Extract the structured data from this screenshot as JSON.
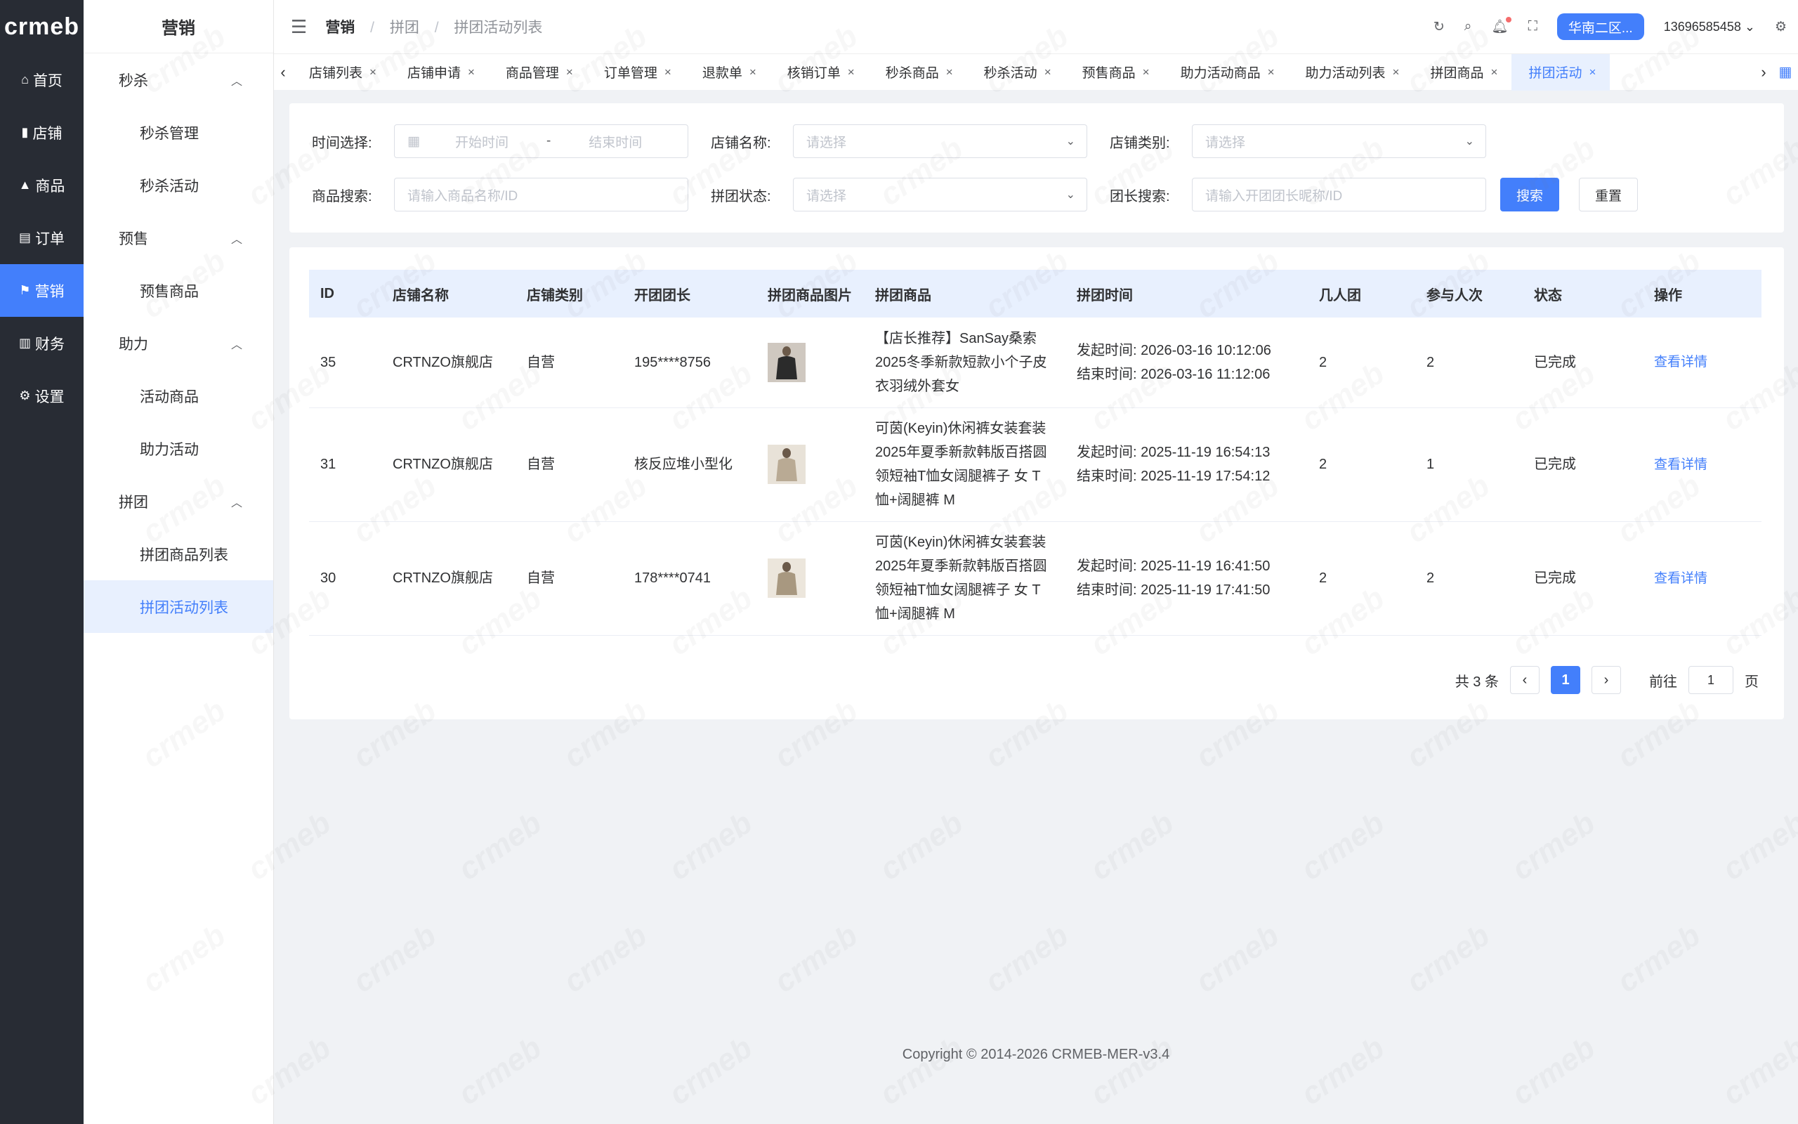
{
  "app": {
    "logo_text": "crmeb",
    "accent": "#437ffb"
  },
  "rail": [
    {
      "label": "首页",
      "icon": "home-icon",
      "glyph": "⌂"
    },
    {
      "label": "店铺",
      "icon": "store-icon",
      "glyph": "▮"
    },
    {
      "label": "商品",
      "icon": "product-icon",
      "glyph": "▲"
    },
    {
      "label": "订单",
      "icon": "order-icon",
      "glyph": "▤"
    },
    {
      "label": "营销",
      "icon": "marketing-flag-icon",
      "glyph": "⚑"
    },
    {
      "label": "财务",
      "icon": "finance-chart-icon",
      "glyph": "▥"
    },
    {
      "label": "设置",
      "icon": "settings-gear-icon",
      "glyph": "⚙"
    }
  ],
  "submenu": {
    "title": "营销",
    "groups": [
      {
        "label": "秒杀",
        "items": [
          "秒杀管理",
          "秒杀活动"
        ]
      },
      {
        "label": "预售",
        "items": [
          "预售商品"
        ]
      },
      {
        "label": "助力",
        "items": [
          "活动商品",
          "助力活动"
        ]
      },
      {
        "label": "拼团",
        "items": [
          "拼团商品列表",
          "拼团活动列表"
        ]
      }
    ]
  },
  "breadcrumb": {
    "root": "营销",
    "mid": "拼团",
    "current": "拼团活动列表",
    "sep": "/"
  },
  "topbar": {
    "region": "华南二区...",
    "phone": "13696585458"
  },
  "tabs": [
    "店铺列表",
    "店铺申请",
    "商品管理",
    "订单管理",
    "退款单",
    "核销订单",
    "秒杀商品",
    "秒杀活动",
    "预售商品",
    "助力活动商品",
    "助力活动列表",
    "拼团商品",
    "拼团活动"
  ],
  "filter": {
    "time_label": "时间选择:",
    "start_placeholder": "开始时间",
    "range_sep": "-",
    "end_placeholder": "结束时间",
    "store_label": "店铺名称:",
    "store_placeholder": "请选择",
    "store_type_label": "店铺类别:",
    "store_type_placeholder": "请选择",
    "goods_label": "商品搜索:",
    "goods_placeholder": "请输入商品名称/ID",
    "status_label": "拼团状态:",
    "status_placeholder": "请选择",
    "leader_label": "团长搜索:",
    "leader_placeholder": "请输入开团团长昵称/ID",
    "search_btn": "搜索",
    "reset_btn": "重置"
  },
  "table": {
    "columns": [
      "ID",
      "店铺名称",
      "店铺类别",
      "开团团长",
      "拼团商品图片",
      "拼团商品",
      "拼团时间",
      "几人团",
      "参与人次",
      "状态",
      "操作"
    ],
    "rows": [
      {
        "id": "35",
        "store": "CRTNZO旗舰店",
        "type": "自营",
        "leader": "195****8756",
        "goods": "【店长推荐】SanSay桑索2025冬季新款短款小个子皮衣羽绒外套女",
        "start": "发起时间:  2026-03-16 10:12:06",
        "end": "结束时间:  2026-03-16 11:12:06",
        "size": "2",
        "joined": "2",
        "status": "已完成",
        "action": "查看详情"
      },
      {
        "id": "31",
        "store": "CRTNZO旗舰店",
        "type": "自营",
        "leader": "核反应堆小型化",
        "goods": "可茵(Keyin)休闲裤女装套装2025年夏季新款韩版百搭圆领短袖T恤女阔腿裤子 女 T恤+阔腿裤 M",
        "start": "发起时间:  2025-11-19 16:54:13",
        "end": "结束时间:  2025-11-19 17:54:12",
        "size": "2",
        "joined": "1",
        "status": "已完成",
        "action": "查看详情"
      },
      {
        "id": "30",
        "store": "CRTNZO旗舰店",
        "type": "自营",
        "leader": "178****0741",
        "goods": "可茵(Keyin)休闲裤女装套装2025年夏季新款韩版百搭圆领短袖T恤女阔腿裤子 女 T恤+阔腿裤 M",
        "start": "发起时间:  2025-11-19 16:41:50",
        "end": "结束时间:  2025-11-19 17:41:50",
        "size": "2",
        "joined": "2",
        "status": "已完成",
        "action": "查看详情"
      }
    ]
  },
  "pagination": {
    "total": "共 3 条",
    "current": "1",
    "goto_label": "前往",
    "goto_value": "1",
    "page_suffix": "页"
  },
  "footer": "Copyright © 2014-2026 CRMEB-MER-v3.4"
}
